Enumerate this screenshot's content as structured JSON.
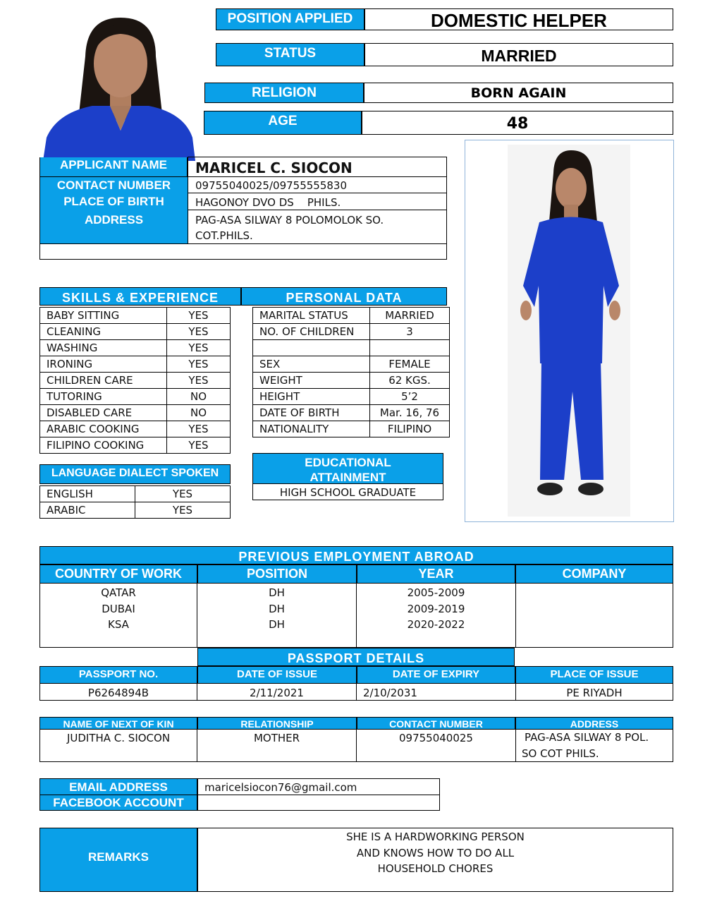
{
  "header": {
    "position_label": "POSITION APPLIED",
    "position_value": "DOMESTIC HELPER",
    "status_label": "STATUS",
    "status_value": "MARRIED",
    "religion_label": "RELIGION",
    "religion_value": "BORN AGAIN",
    "age_label": "AGE",
    "age_value": "48"
  },
  "applicant": {
    "name_label": "APPLICANT NAME",
    "name_value": "MARICEL C. SIOCON",
    "contact_label": "CONTACT NUMBER",
    "contact_value": "09755040025/09755555830",
    "birthplace_label": "PLACE OF BIRTH",
    "birthplace_value": "HAGONOY DVO DS    PHILS.",
    "address_label": "ADDRESS",
    "address_line1": "PAG-ASA SILWAY 8 POLOMOLOK SO.",
    "address_line2": "COT.PHILS."
  },
  "skills": {
    "title": "SKILLS & EXPERIENCE",
    "rows": [
      {
        "skill": "BABY SITTING",
        "value": "YES"
      },
      {
        "skill": "CLEANING",
        "value": "YES"
      },
      {
        "skill": "WASHING",
        "value": "YES"
      },
      {
        "skill": "IRONING",
        "value": "YES"
      },
      {
        "skill": "CHILDREN CARE",
        "value": "YES"
      },
      {
        "skill": "TUTORING",
        "value": "NO"
      },
      {
        "skill": "DISABLED CARE",
        "value": "NO"
      },
      {
        "skill": "ARABIC COOKING",
        "value": "YES"
      },
      {
        "skill": "FILIPINO COOKING",
        "value": "YES"
      }
    ]
  },
  "personal": {
    "title": "PERSONAL DATA",
    "rows": [
      {
        "label": "MARITAL STATUS",
        "value": "MARRIED"
      },
      {
        "label": "NO. OF CHILDREN",
        "value": "3"
      },
      {
        "label": "",
        "value": ""
      },
      {
        "label": "SEX",
        "value": "FEMALE"
      },
      {
        "label": "WEIGHT",
        "value": "62 KGS."
      },
      {
        "label": "HEIGHT",
        "value": "5’2"
      },
      {
        "label": "DATE OF BIRTH",
        "value": "Mar. 16, 76"
      },
      {
        "label": "NATIONALITY",
        "value": "FILIPINO"
      }
    ]
  },
  "language": {
    "title": "LANGUAGE DIALECT SPOKEN",
    "rows": [
      {
        "lang": "ENGLISH",
        "value": "YES"
      },
      {
        "lang": "ARABIC",
        "value": "YES"
      }
    ]
  },
  "education": {
    "title_line1": "EDUCATIONAL",
    "title_line2": "ATTAINMENT",
    "value": "HIGH SCHOOL GRADUATE"
  },
  "employment": {
    "title": "PREVIOUS EMPLOYMENT ABROAD",
    "headers": [
      "COUNTRY OF WORK",
      "POSITION",
      "YEAR",
      "COMPANY"
    ],
    "rows": [
      {
        "country": "QATAR",
        "position": "DH",
        "year": "2005-2009",
        "company": ""
      },
      {
        "country": "DUBAI",
        "position": "DH",
        "year": "2009-2019",
        "company": ""
      },
      {
        "country": "KSA",
        "position": "DH",
        "year": "2020-2022",
        "company": ""
      }
    ]
  },
  "passport": {
    "title": "PASSPORT DETAILS",
    "headers": [
      "PASSPORT NO.",
      "DATE OF ISSUE",
      "DATE OF EXPIRY",
      "PLACE OF ISSUE"
    ],
    "values": [
      "P6264894B",
      "2/11/2021",
      "2/10/2031",
      "PE RIYADH"
    ]
  },
  "kin": {
    "headers": [
      "NAME OF NEXT OF KIN",
      "RELATIONSHIP",
      "CONTACT NUMBER",
      "ADDRESS"
    ],
    "name": "JUDITHA C. SIOCON",
    "relationship": "MOTHER",
    "contact": "09755040025",
    "address_line1": "PAG-ASA SILWAY 8 POL.",
    "address_line2": "SO COT PHILS."
  },
  "online": {
    "email_label": "EMAIL ADDRESS",
    "email_value": "maricelsiocon76@gmail.com",
    "facebook_label": "FACEBOOK ACCOUNT",
    "facebook_value": ""
  },
  "remarks": {
    "label": "REMARKS",
    "line1": "SHE IS A HARDWORKING PERSON",
    "line2": "AND KNOWS HOW TO DO ALL",
    "line3": "HOUSEHOLD CHORES"
  },
  "colors": {
    "accent": "#0aa0e8",
    "uniform": "#1c3fc9"
  }
}
